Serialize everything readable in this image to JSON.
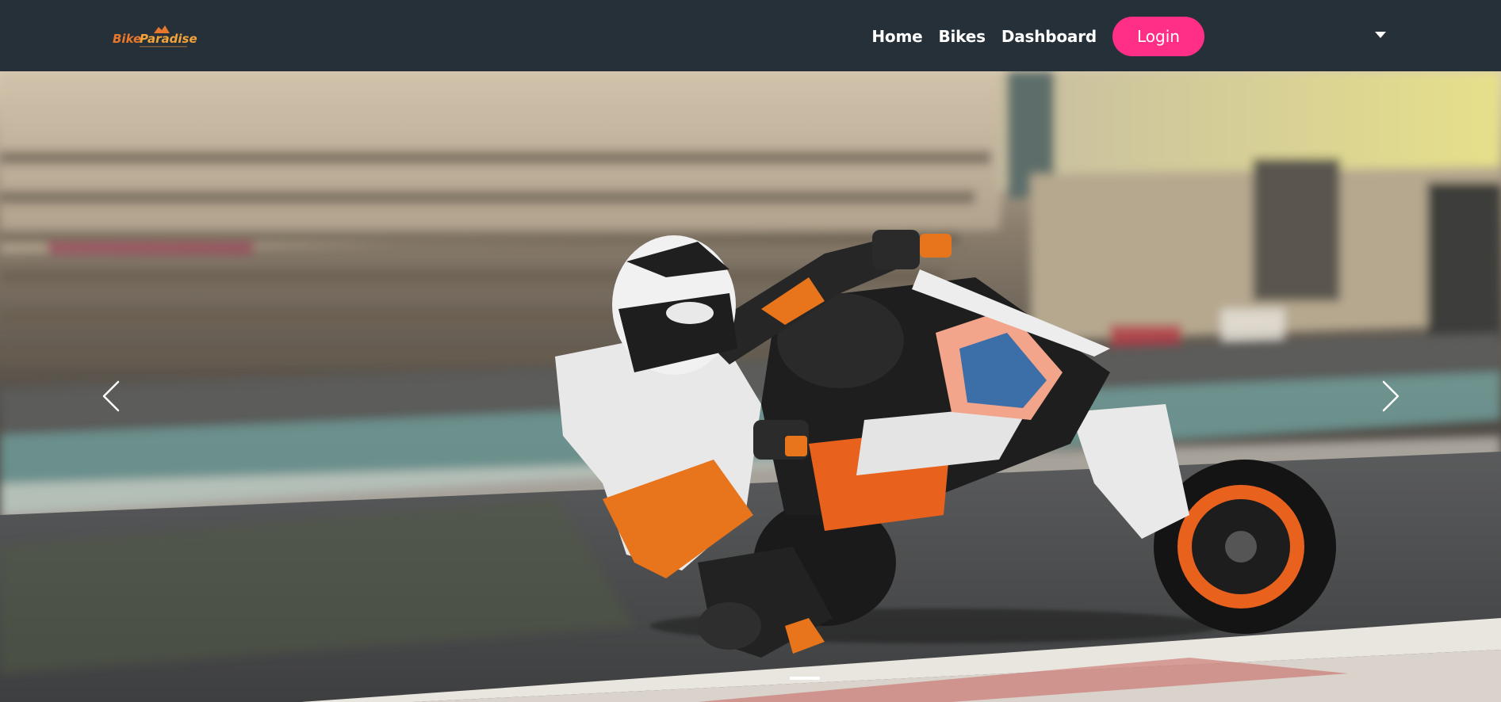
{
  "brand": {
    "logo_text_part1": "Bike",
    "logo_text_part2": "Paradise",
    "colors": {
      "accent": "#ff2e86",
      "navbar": "#263038",
      "logo_orange": "#e8762b"
    }
  },
  "nav": {
    "links": [
      {
        "label": "Home"
      },
      {
        "label": "Bikes"
      },
      {
        "label": "Dashboard"
      }
    ],
    "login_label": "Login",
    "dropdown_icon": "caret-down-icon"
  },
  "carousel": {
    "slide_image": "motorcycle-racer-leaning-on-track",
    "prev_icon": "chevron-left-icon",
    "next_icon": "chevron-right-icon",
    "active_slide": 1,
    "slide_count": 1
  }
}
